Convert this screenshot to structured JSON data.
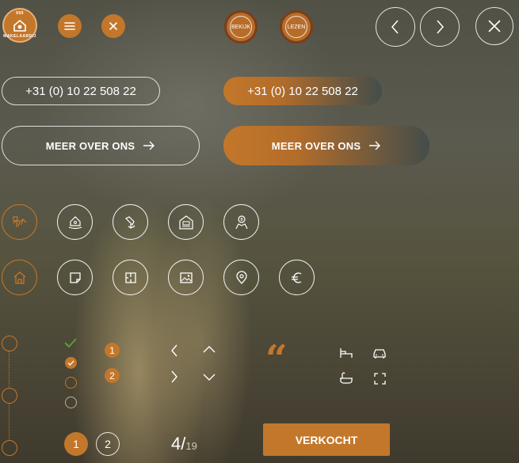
{
  "header": {
    "logo": {
      "text_top": "999",
      "text_bottom": "MAKELAARDIJ"
    },
    "bekijk_label": "BEKIJK",
    "lezen_label": "LEZEN"
  },
  "contact": {
    "phone_outline": "+31 (0) 10 22 508 22",
    "phone_filled": "+31 (0) 10 22 508 22"
  },
  "cta": {
    "outline_label": "MEER OVER ONS",
    "filled_label": "MEER OVER ONS"
  },
  "service_icons": [
    "handshake-icon",
    "house-hand-icon",
    "wrench-tool-icon",
    "rent-house-icon",
    "money-person-icon"
  ],
  "property_icons": [
    "home-icon",
    "note-icon",
    "floorplan-icon",
    "image-icon",
    "location-pin-icon",
    "euro-icon"
  ],
  "checklist": {
    "numbers": [
      "1",
      "2"
    ]
  },
  "pagination": {
    "pages": [
      "1",
      "2"
    ],
    "active_page": "1",
    "current": "4/",
    "total": "19"
  },
  "quote_mark": "“",
  "status_button": "VERKOCHT",
  "colors": {
    "accent": "#c3772a",
    "accent_dark": "#7a3e19"
  }
}
